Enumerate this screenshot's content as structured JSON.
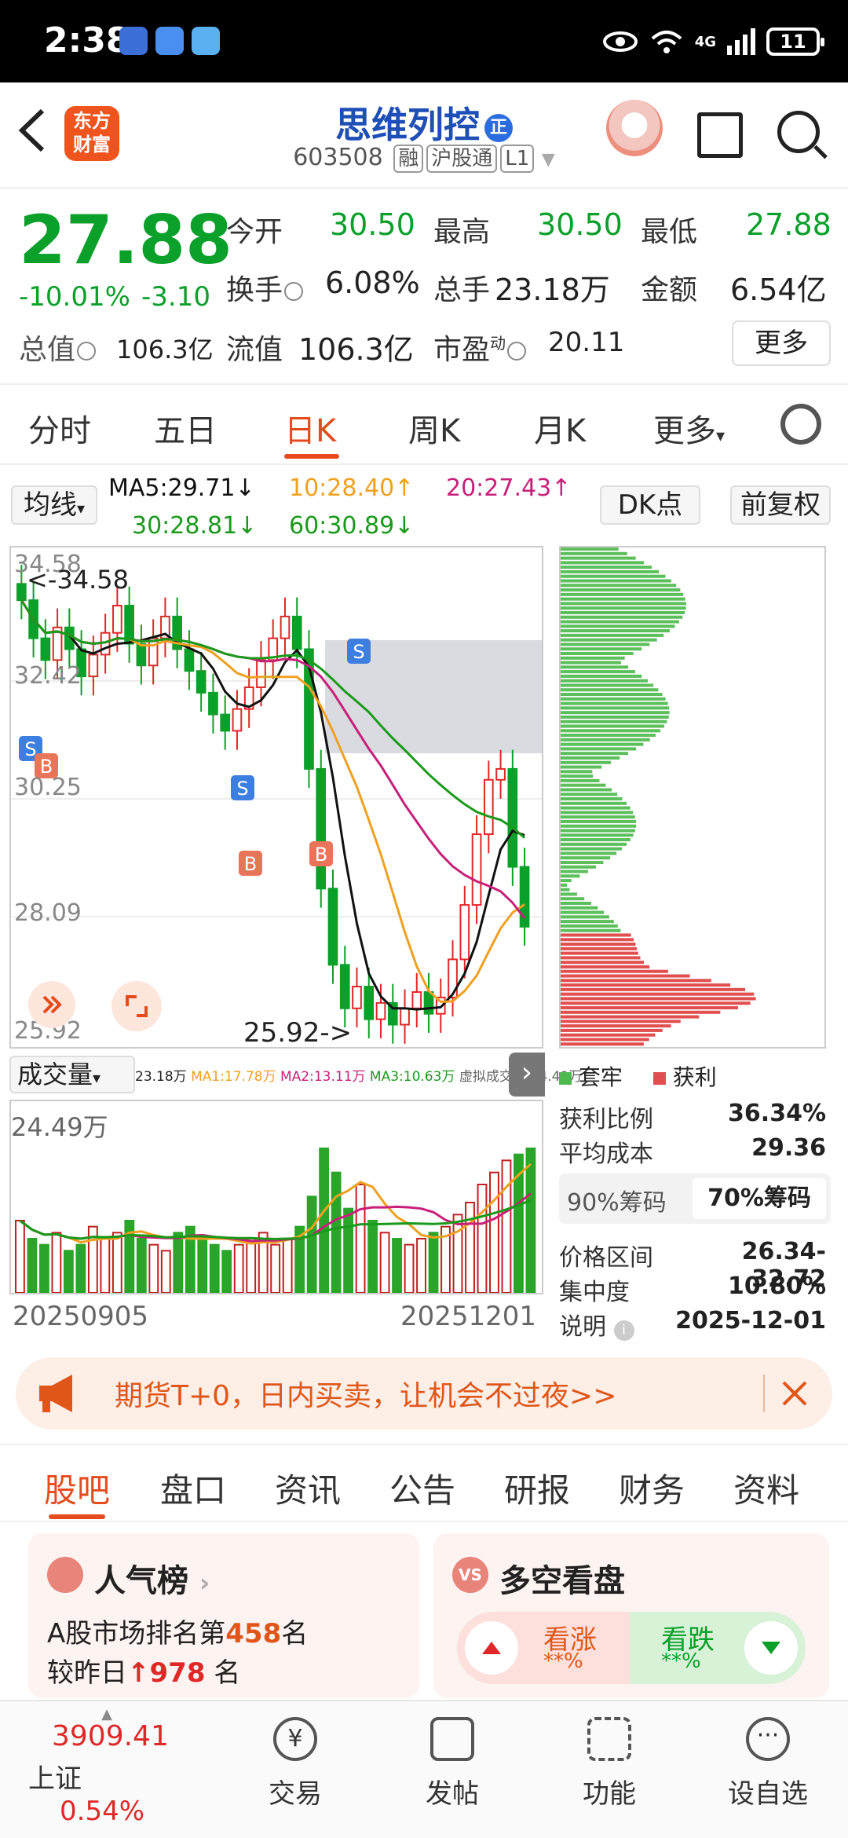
{
  "status_bar": {
    "time": "2:38",
    "network": "4G",
    "battery": "11"
  },
  "header": {
    "stock_name": "思维列控",
    "zheng_badge": "正",
    "code": "603508",
    "tags": [
      "融",
      "沪股通",
      "L1"
    ],
    "logo_text": "东方财富"
  },
  "quote": {
    "price": "27.88",
    "change_pct": "-10.01%",
    "change_abs": "-3.10",
    "open_label": "今开",
    "open": "30.50",
    "high_label": "最高",
    "high": "30.50",
    "low_label": "最低",
    "low": "27.88",
    "turnover_label": "换手",
    "turnover": "6.08%",
    "volume_label": "总手",
    "volume": "23.18万",
    "amount_label": "金额",
    "amount": "6.54亿",
    "mktcap_label": "总值",
    "mktcap": "106.3亿",
    "float_label": "流值",
    "float": "106.3亿",
    "pe_label": "市盈",
    "pe_sup": "动",
    "pe": "20.11",
    "more": "更多"
  },
  "period_tabs": [
    "分时",
    "五日",
    "日K",
    "周K",
    "月K",
    "更多"
  ],
  "period_active": "日K",
  "ma_bar": {
    "avg_label": "均线",
    "ma5": "MA5:29.71↓",
    "ma10": "10:28.40↑",
    "ma20": "20:27.43↑",
    "ma30": "30:28.81↓",
    "ma60": "60:30.89↓",
    "dk": "DK点",
    "fq": "前复权"
  },
  "chart_data": {
    "type": "candlestick",
    "y_labels": [
      "34.58",
      "32.42",
      "30.25",
      "28.09",
      "25.92"
    ],
    "ylim": [
      25.92,
      34.58
    ],
    "max_label": "34.58",
    "min_label": "25.92",
    "closes": [
      33.9,
      33.2,
      32.8,
      33.4,
      33.0,
      32.5,
      32.9,
      33.3,
      33.8,
      33.1,
      32.7,
      33.2,
      33.6,
      33.0,
      32.6,
      32.2,
      31.8,
      31.5,
      31.9,
      32.3,
      32.8,
      33.2,
      33.6,
      33.0,
      30.8,
      28.6,
      27.2,
      26.4,
      26.8,
      26.2,
      26.5,
      26.1,
      26.4,
      26.7,
      26.3,
      26.6,
      27.3,
      28.3,
      29.6,
      30.6,
      30.8,
      29.0,
      27.9
    ],
    "x_start": "20250905",
    "x_end": "20251201",
    "signals": [
      "S",
      "B",
      "S",
      "B",
      "B",
      "S"
    ]
  },
  "volume": {
    "label": "成交量",
    "legend": [
      "23.18万",
      "MA1:17.78万",
      "MA2:13.11万",
      "MA3:10.63万",
      "虚拟成交量:24.49万"
    ],
    "max_label": "24.49万",
    "values": [
      12,
      9,
      8,
      10,
      7,
      8,
      11,
      9,
      10,
      12,
      9,
      8,
      7,
      10,
      11,
      9,
      8,
      7,
      8,
      9,
      10,
      8,
      9,
      11,
      16,
      24,
      20,
      14,
      18,
      12,
      10,
      9,
      8,
      9,
      10,
      11,
      13,
      15,
      18,
      20,
      22,
      23,
      24
    ]
  },
  "chip": {
    "legend_trapped": "套牢",
    "legend_profit": "获利",
    "profit_ratio_label": "获利比例",
    "profit_ratio": "36.34%",
    "avg_cost_label": "平均成本",
    "avg_cost": "29.36",
    "tab90": "90%筹码",
    "tab70": "70%筹码",
    "range_label": "价格区间",
    "range": "26.34-32.72",
    "concentration_label": "集中度",
    "concentration": "10.80%",
    "note_label": "说明",
    "date": "2025-12-01"
  },
  "ad": {
    "text": "期货T+0，日内买卖，让机会不过夜>>"
  },
  "bottom_tabs": [
    "股吧",
    "盘口",
    "资讯",
    "公告",
    "研报",
    "财务",
    "资料"
  ],
  "bottom_active": "股吧",
  "cards": {
    "rank_title": "人气榜",
    "rank_line1_pre": "A股市场排名第",
    "rank_num": "458",
    "rank_line1_post": "名",
    "rank_line2_pre": "较昨日",
    "rank_change": "978",
    "rank_line2_post": "名",
    "vs_title": "多空看盘",
    "vs_badge": "VS",
    "bull_label": "看涨",
    "bull_val": "**%",
    "bear_label": "看跌",
    "bear_val": "**%"
  },
  "footer": {
    "index_value": "3909.41",
    "index_name": "上证",
    "index_pct": "0.54%",
    "items": [
      "交易",
      "发帖",
      "功能",
      "设自选"
    ],
    "trade_glyph": "¥"
  },
  "colors": {
    "up": "#e02828",
    "down": "#0aa02a",
    "accent": "#e64b1e",
    "ma5": "#111111",
    "ma10": "#f0a020",
    "ma20": "#c8207a",
    "ma30": "#1a9a1a",
    "ma60": "#1a9a1a"
  }
}
